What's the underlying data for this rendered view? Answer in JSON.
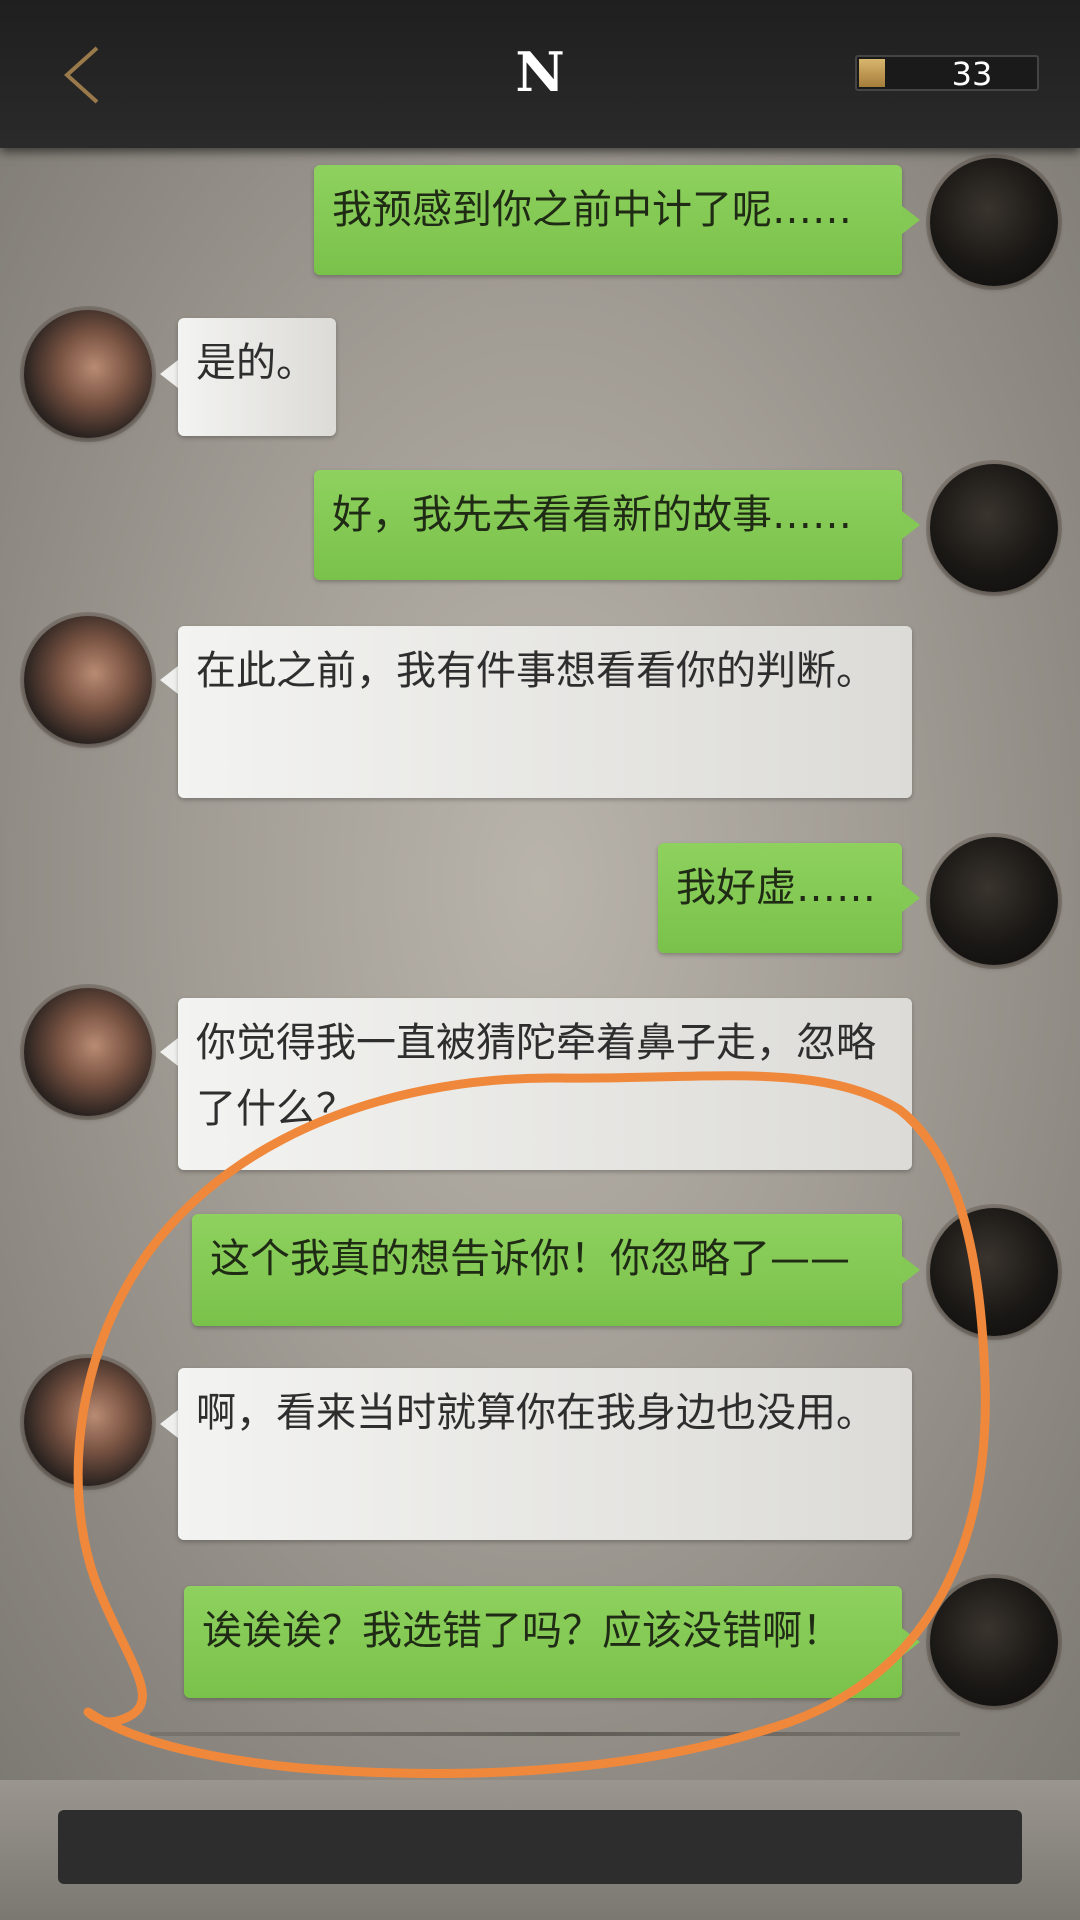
{
  "header": {
    "title": "N",
    "counter": "33",
    "counter_level": 0.15
  },
  "messages": [
    {
      "side": "right",
      "text": "我预感到你之前中计了呢……"
    },
    {
      "side": "left",
      "text": "是的。"
    },
    {
      "side": "right",
      "text": "好，我先去看看新的故事……"
    },
    {
      "side": "left",
      "text": "在此之前，我有件事想看看你的判断。"
    },
    {
      "side": "right",
      "text": "我好虚……"
    },
    {
      "side": "left",
      "text": "你觉得我一直被猜陀牵着鼻子走，忽略了什么？"
    },
    {
      "side": "right",
      "text": "这个我真的想告诉你！你忽略了——"
    },
    {
      "side": "left",
      "text": "啊，看来当时就算你在我身边也没用。"
    },
    {
      "side": "right",
      "text": "诶诶诶？我选错了吗？应该没错啊！"
    }
  ],
  "colors": {
    "accent_back": "#9a7a4a",
    "self_bubble": "#84c955",
    "other_bubble": "#efefed",
    "annotation": "#f0883c"
  }
}
